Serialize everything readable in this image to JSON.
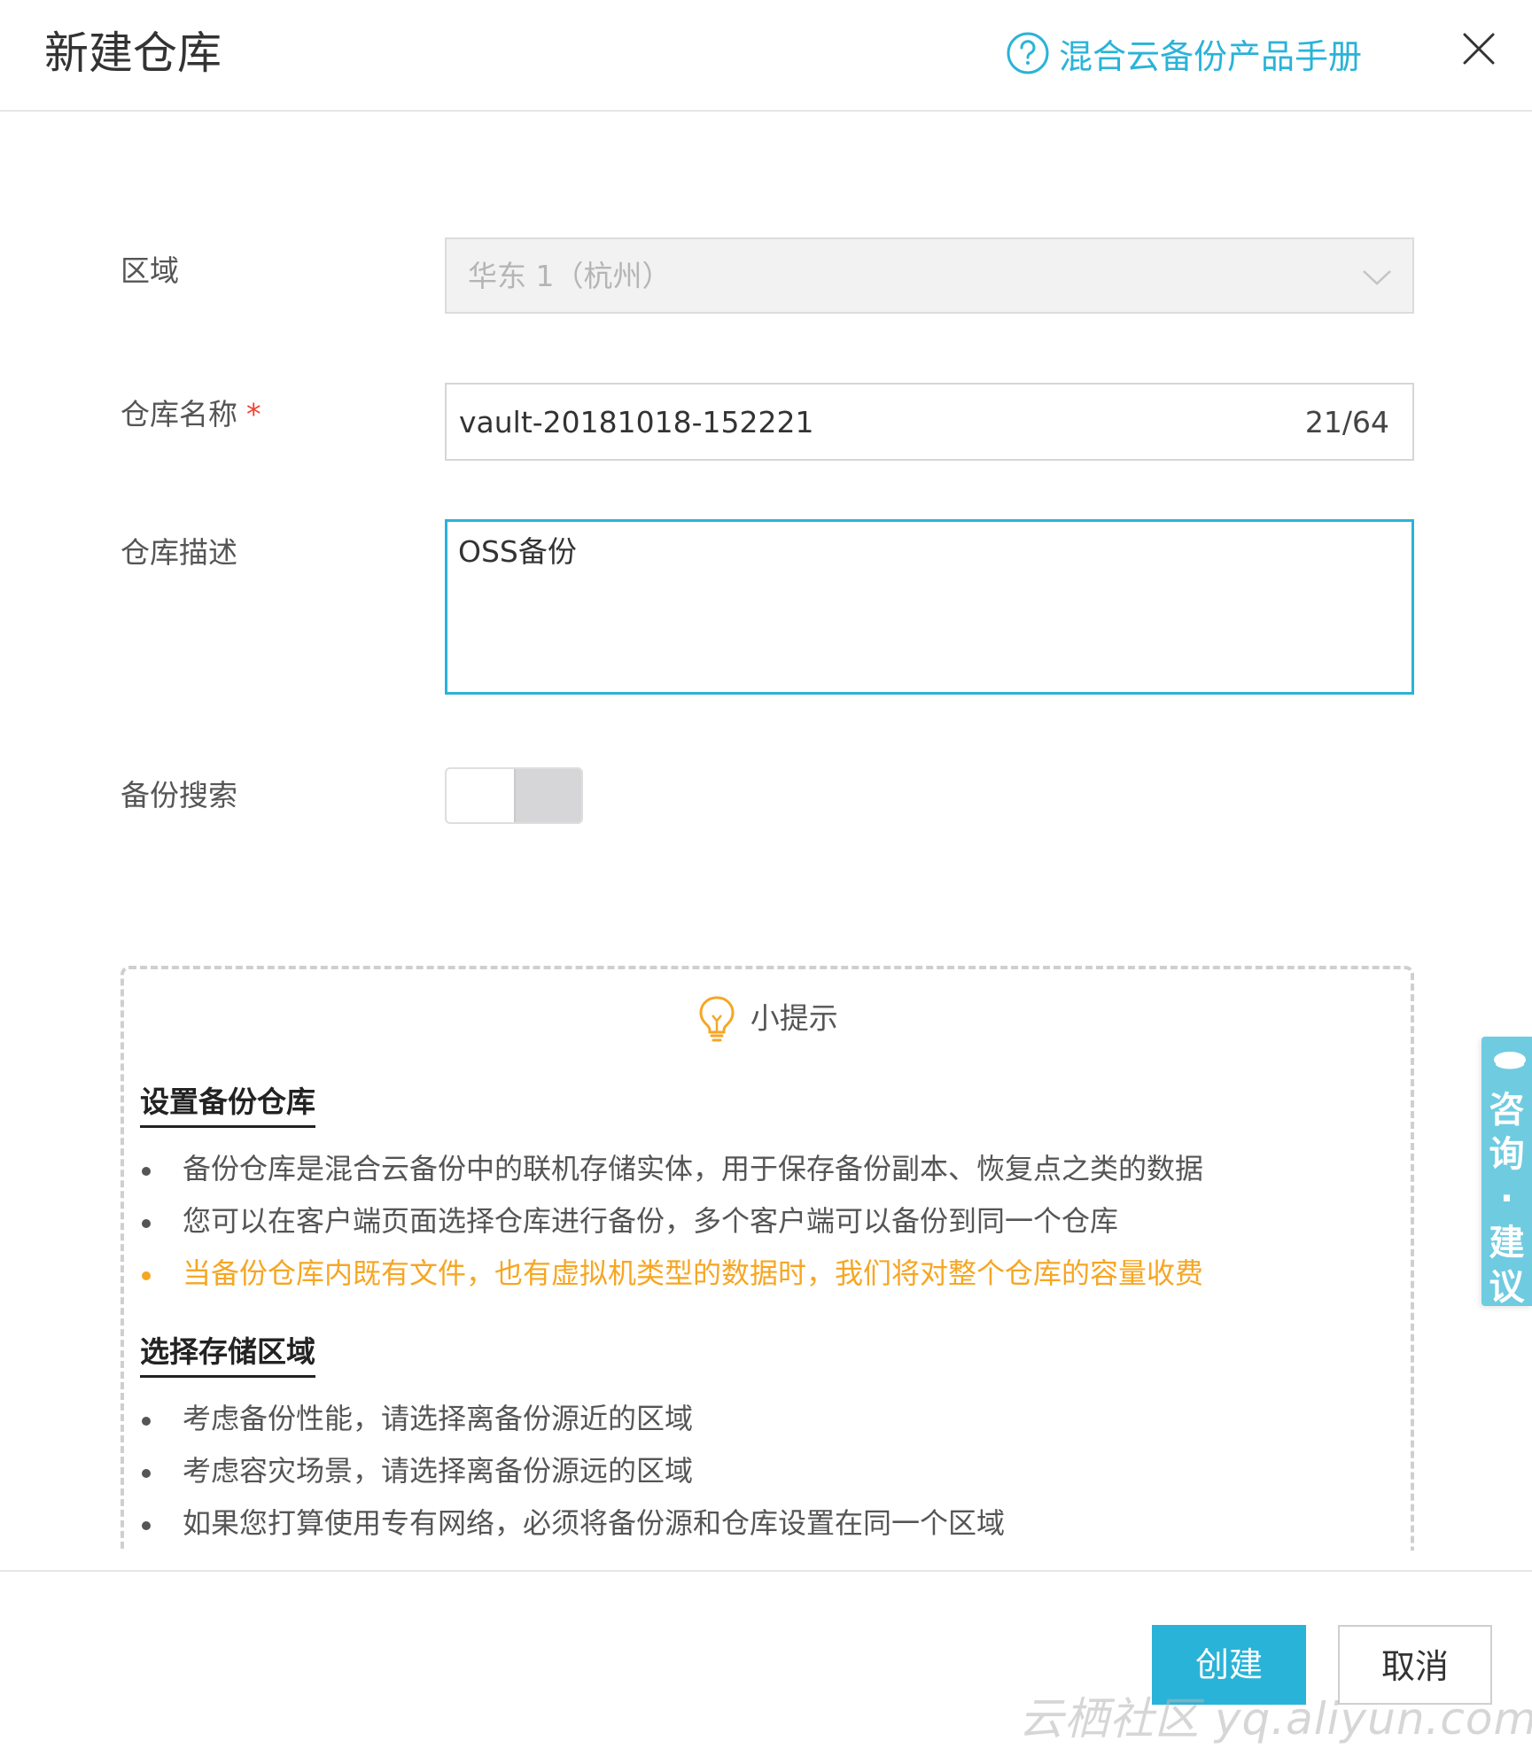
{
  "dialog": {
    "title": "新建仓库",
    "manual_link": "混合云备份产品手册"
  },
  "form": {
    "region": {
      "label": "区域",
      "value": "华东 1（杭州）"
    },
    "vault_name": {
      "label": "仓库名称",
      "required_mark": "*",
      "value": "vault-20181018-152221",
      "counter": "21/64"
    },
    "vault_desc": {
      "label": "仓库描述",
      "value": "OSS备份"
    },
    "backup_search": {
      "label": "备份搜索",
      "enabled": false
    }
  },
  "tips": {
    "title": "小提示",
    "sections": [
      {
        "heading": "设置备份仓库",
        "items": [
          {
            "text": "备份仓库是混合云备份中的联机存储实体，用于保存备份副本、恢复点之类的数据",
            "warn": false
          },
          {
            "text": "您可以在客户端页面选择仓库进行备份，多个客户端可以备份到同一个仓库",
            "warn": false
          },
          {
            "text": "当备份仓库内既有文件，也有虚拟机类型的数据时，我们将对整个仓库的容量收费",
            "warn": true
          }
        ]
      },
      {
        "heading": "选择存储区域",
        "items": [
          {
            "text": "考虑备份性能，请选择离备份源近的区域",
            "warn": false
          },
          {
            "text": "考虑容灾场景，请选择离备份源远的区域",
            "warn": false
          },
          {
            "text": "如果您打算使用专有网络，必须将备份源和仓库设置在同一个区域",
            "warn": false
          }
        ]
      }
    ]
  },
  "footer": {
    "create_label": "创建",
    "cancel_label": "取消",
    "watermark": "云栖社区 yq.aliyun.com"
  },
  "side_tab": {
    "label": "咨询·建议"
  },
  "colors": {
    "accent": "#2ab3d8",
    "warning": "#f6a623",
    "required": "#f04134"
  },
  "icons": [
    "help-circle-icon",
    "close-icon",
    "chevron-down-icon",
    "lightbulb-icon",
    "chat-icon"
  ]
}
